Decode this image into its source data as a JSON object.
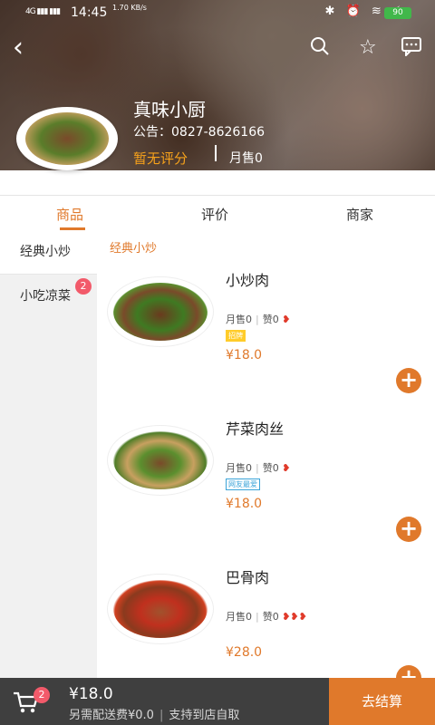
{
  "status_bar": {
    "signal": "4G ▮▮▮ ▮▮▮",
    "time": "14:45",
    "net_speed": "1.70 KB/s",
    "icons": "✱ ⏰ ≋ ⚡",
    "battery": "90"
  },
  "topbar": {
    "back_icon": "‹",
    "search_icon": "⌕",
    "star_icon": "☆",
    "message_icon": "⋯"
  },
  "shop": {
    "name": "真味小厨",
    "notice": "公告：0827-8626166",
    "rating": "暂无评分",
    "monthly_sales": "月售0"
  },
  "tabs": [
    {
      "label": "商品",
      "active": true
    },
    {
      "label": "评价",
      "active": false
    },
    {
      "label": "商家",
      "active": false
    }
  ],
  "sidebar": {
    "items": [
      {
        "label": "经典小炒",
        "badge": ""
      },
      {
        "label": "小吃凉菜",
        "badge": "2"
      }
    ]
  },
  "section": {
    "title": "经典小炒"
  },
  "dishes": [
    {
      "name": "小炒肉",
      "sales": "月售0",
      "likes": "赞0",
      "spice": "❥",
      "tag": "招牌",
      "price": "¥18.0"
    },
    {
      "name": "芹菜肉丝",
      "sales": "月售0",
      "likes": "赞0",
      "spice": "❥",
      "tag": "网友最爱",
      "price": "¥18.0"
    },
    {
      "name": "巴骨肉",
      "sales": "月售0",
      "likes": "赞0",
      "spice": "❥❥❥",
      "tag": "",
      "price": "¥28.0"
    }
  ],
  "cart": {
    "count": "2",
    "total": "¥18.0",
    "delivery": "另需配送费¥0.0",
    "pickup": "支持到店自取",
    "checkout": "去结算"
  },
  "colors": {
    "accent": "#e0792b",
    "badge": "#f25a6a",
    "bottom_bar": "#3f3f3f",
    "rating": "#f7a21b"
  }
}
